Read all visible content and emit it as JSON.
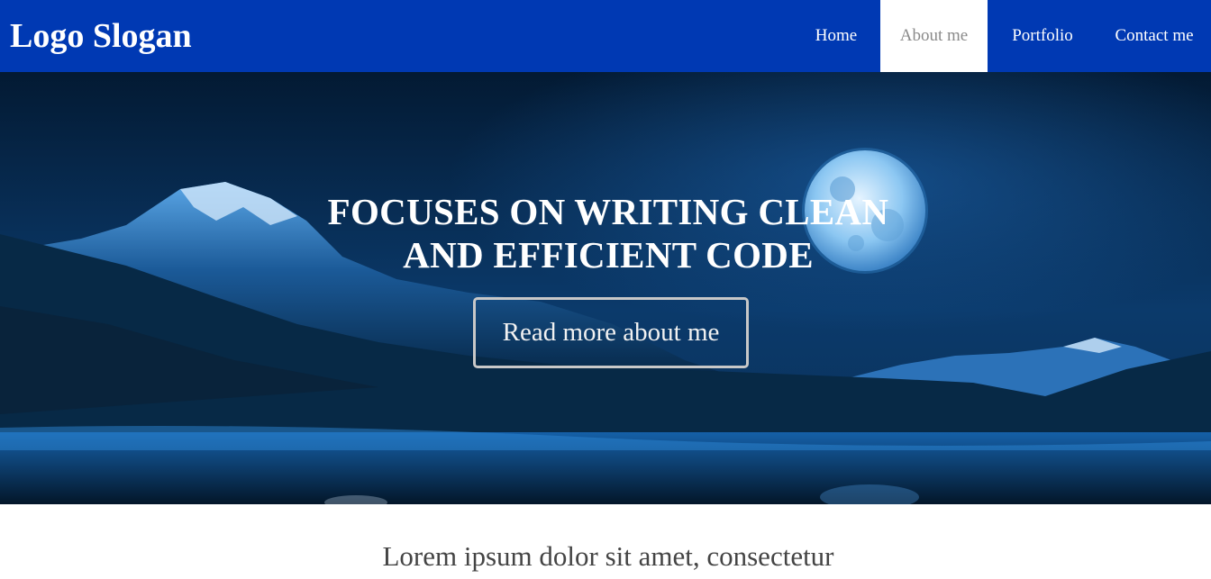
{
  "header": {
    "logo_text": "Logo Slogan",
    "nav": [
      {
        "label": "Home",
        "active": false
      },
      {
        "label": "About me",
        "active": true
      },
      {
        "label": "Portfolio",
        "active": false
      },
      {
        "label": "Contact me",
        "active": false
      }
    ]
  },
  "hero": {
    "title_line1": "FOCUSES ON WRITING CLEAN",
    "title_line2": "AND EFFICIENT CODE",
    "button_label": "Read more about me",
    "image": "night-mountain-lake-with-full-moon"
  },
  "content": {
    "lead_text": "Lorem ipsum dolor sit amet, consectetur"
  },
  "colors": {
    "header_bg": "#0039b3",
    "active_nav_bg": "#ffffff",
    "active_nav_text": "#8a8a8a",
    "text_dark": "#444444"
  }
}
